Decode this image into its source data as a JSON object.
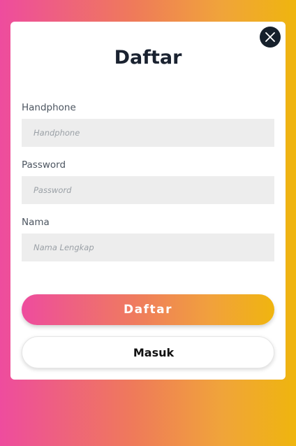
{
  "modal": {
    "title": "Daftar",
    "close_icon": "close-icon",
    "fields": [
      {
        "label": "Handphone",
        "placeholder": "Handphone",
        "value": ""
      },
      {
        "label": "Password",
        "placeholder": "Password",
        "value": ""
      },
      {
        "label": "Nama",
        "placeholder": "Nama Lengkap",
        "value": ""
      }
    ],
    "primary_button": "Daftar",
    "secondary_button": "Masuk"
  },
  "colors": {
    "gradient_start": "#ee4c9e",
    "gradient_end": "#efb50e",
    "title": "#1a2230",
    "input_bg": "#ededed",
    "close_bg": "#16202b"
  }
}
